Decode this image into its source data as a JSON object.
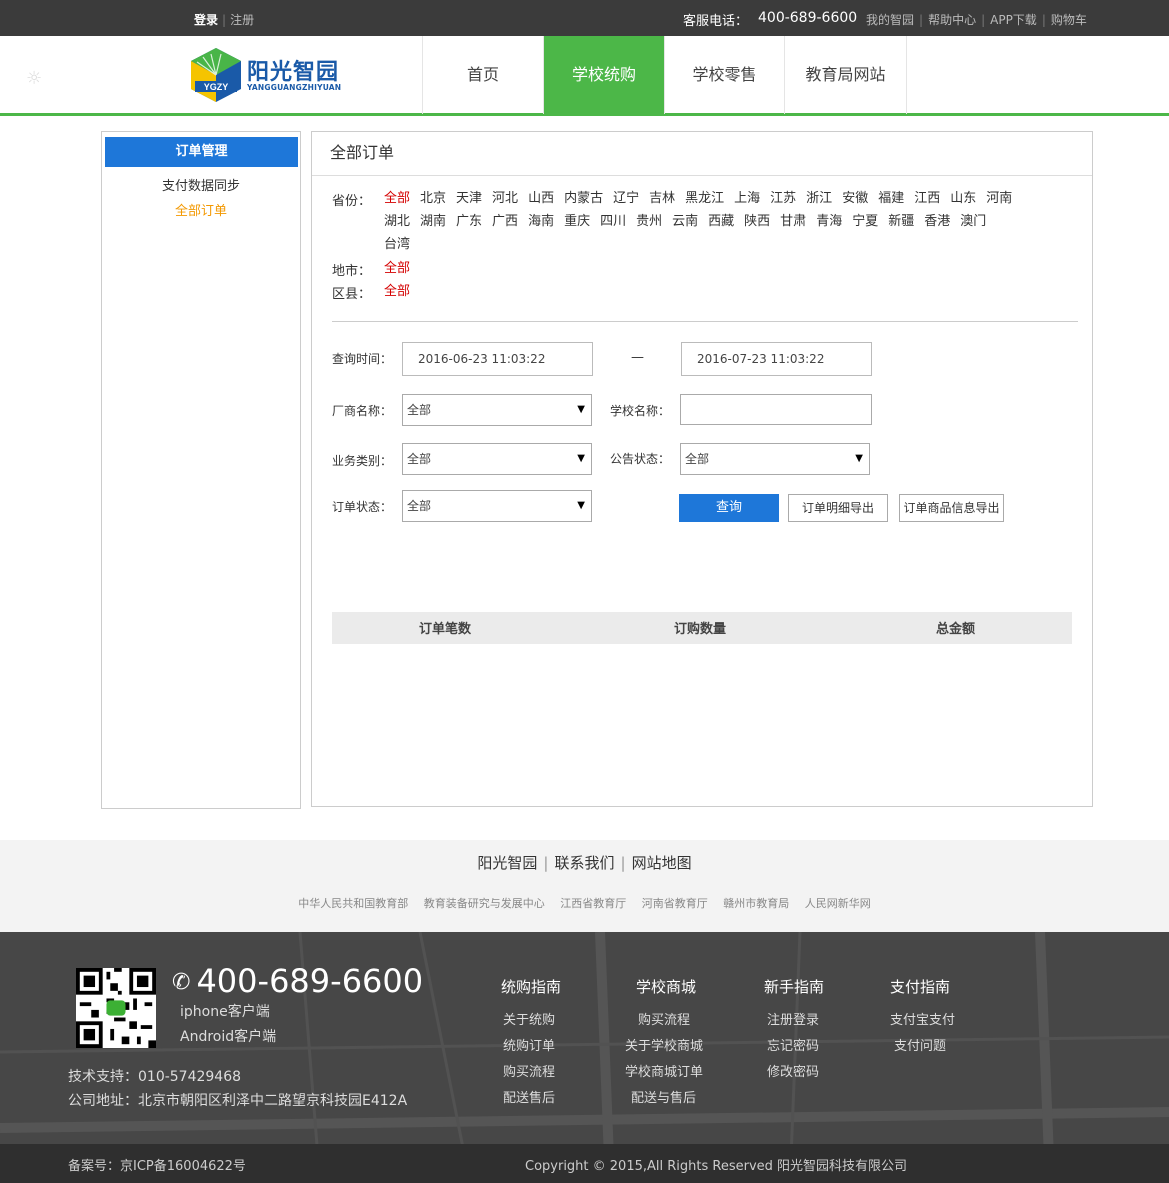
{
  "topbar": {
    "login": "登录",
    "register": "注册",
    "phone_label": "客服电话：",
    "phone_number": "400-689-6600",
    "links": [
      "我的智园",
      "帮助中心",
      "APP下载",
      "购物车"
    ]
  },
  "logo": {
    "badge": "YGZY",
    "name": "阳光智园",
    "pinyin": "YANGGUANGZHIYUAN"
  },
  "nav": {
    "items": [
      "首页",
      "学校统购",
      "学校零售",
      "教育局网站"
    ],
    "active_index": 1,
    "active_color": "#4cb748"
  },
  "sidebar": {
    "title": "订单管理",
    "items": [
      "支付数据同步",
      "全部订单"
    ],
    "active_item": "全部订单"
  },
  "main": {
    "title": "全部订单",
    "province_label": "省份：",
    "provinces": [
      "全部",
      "北京",
      "天津",
      "河北",
      "山西",
      "内蒙古",
      "辽宁",
      "吉林",
      "黑龙江",
      "上海",
      "江苏",
      "浙江",
      "安徽",
      "福建",
      "江西",
      "山东",
      "河南",
      "湖北",
      "湖南",
      "广东",
      "广西",
      "海南",
      "重庆",
      "四川",
      "贵州",
      "云南",
      "西藏",
      "陕西",
      "甘肃",
      "青海",
      "宁夏",
      "新疆",
      "香港",
      "澳门",
      "台湾"
    ],
    "city_label": "地市：",
    "city_value": "全部",
    "district_label": "区县：",
    "district_value": "全部",
    "form": {
      "time_label": "查询时间：",
      "start_time": "2016-06-23 11:03:22",
      "time_sep": "—",
      "end_time": "2016-07-23 11:03:22",
      "vendor_label": "厂商名称：",
      "vendor_value": "全部",
      "school_label": "学校名称：",
      "school_value": "",
      "biz_label": "业务类别：",
      "biz_value": "全部",
      "notice_label": "公告状态：",
      "notice_value": "全部",
      "order_status_label": "订单状态：",
      "order_status_value": "全部",
      "query_button": "查询",
      "export_detail_button": "订单明细导出",
      "export_goods_button": "订单商品信息导出"
    },
    "summary": [
      "订单笔数",
      "订购数量",
      "总金额"
    ]
  },
  "footer": {
    "main_links": [
      "阳光智园",
      "联系我们",
      "网站地图"
    ],
    "sub_links": [
      "中华人民共和国教育部",
      "教育装备研究与发展中心",
      "江西省教育厅",
      "河南省教育厅",
      "赣州市教育局",
      "人民网新华网"
    ],
    "hotline": "400-689-6600",
    "clients": [
      "iphone客户端",
      "Android客户端"
    ],
    "tech_support": "技术支持：010-57429468",
    "address": "公司地址：北京市朝阳区利泽中二路望京科技园E412A",
    "columns": [
      {
        "title": "统购指南",
        "items": [
          "关于统购",
          "统购订单",
          "购买流程",
          "配送售后"
        ]
      },
      {
        "title": "学校商城",
        "items": [
          "购买流程",
          "关于学校商城",
          "学校商城订单",
          "配送与售后"
        ]
      },
      {
        "title": "新手指南",
        "items": [
          "注册登录",
          "忘记密码",
          "修改密码"
        ]
      },
      {
        "title": "支付指南",
        "items": [
          "支付宝支付",
          "支付问题"
        ]
      }
    ],
    "icp": "备案号：京ICP备16004622号",
    "copyright": "Copyright © 2015,All Rights Reserved 阳光智园科技有限公司"
  }
}
